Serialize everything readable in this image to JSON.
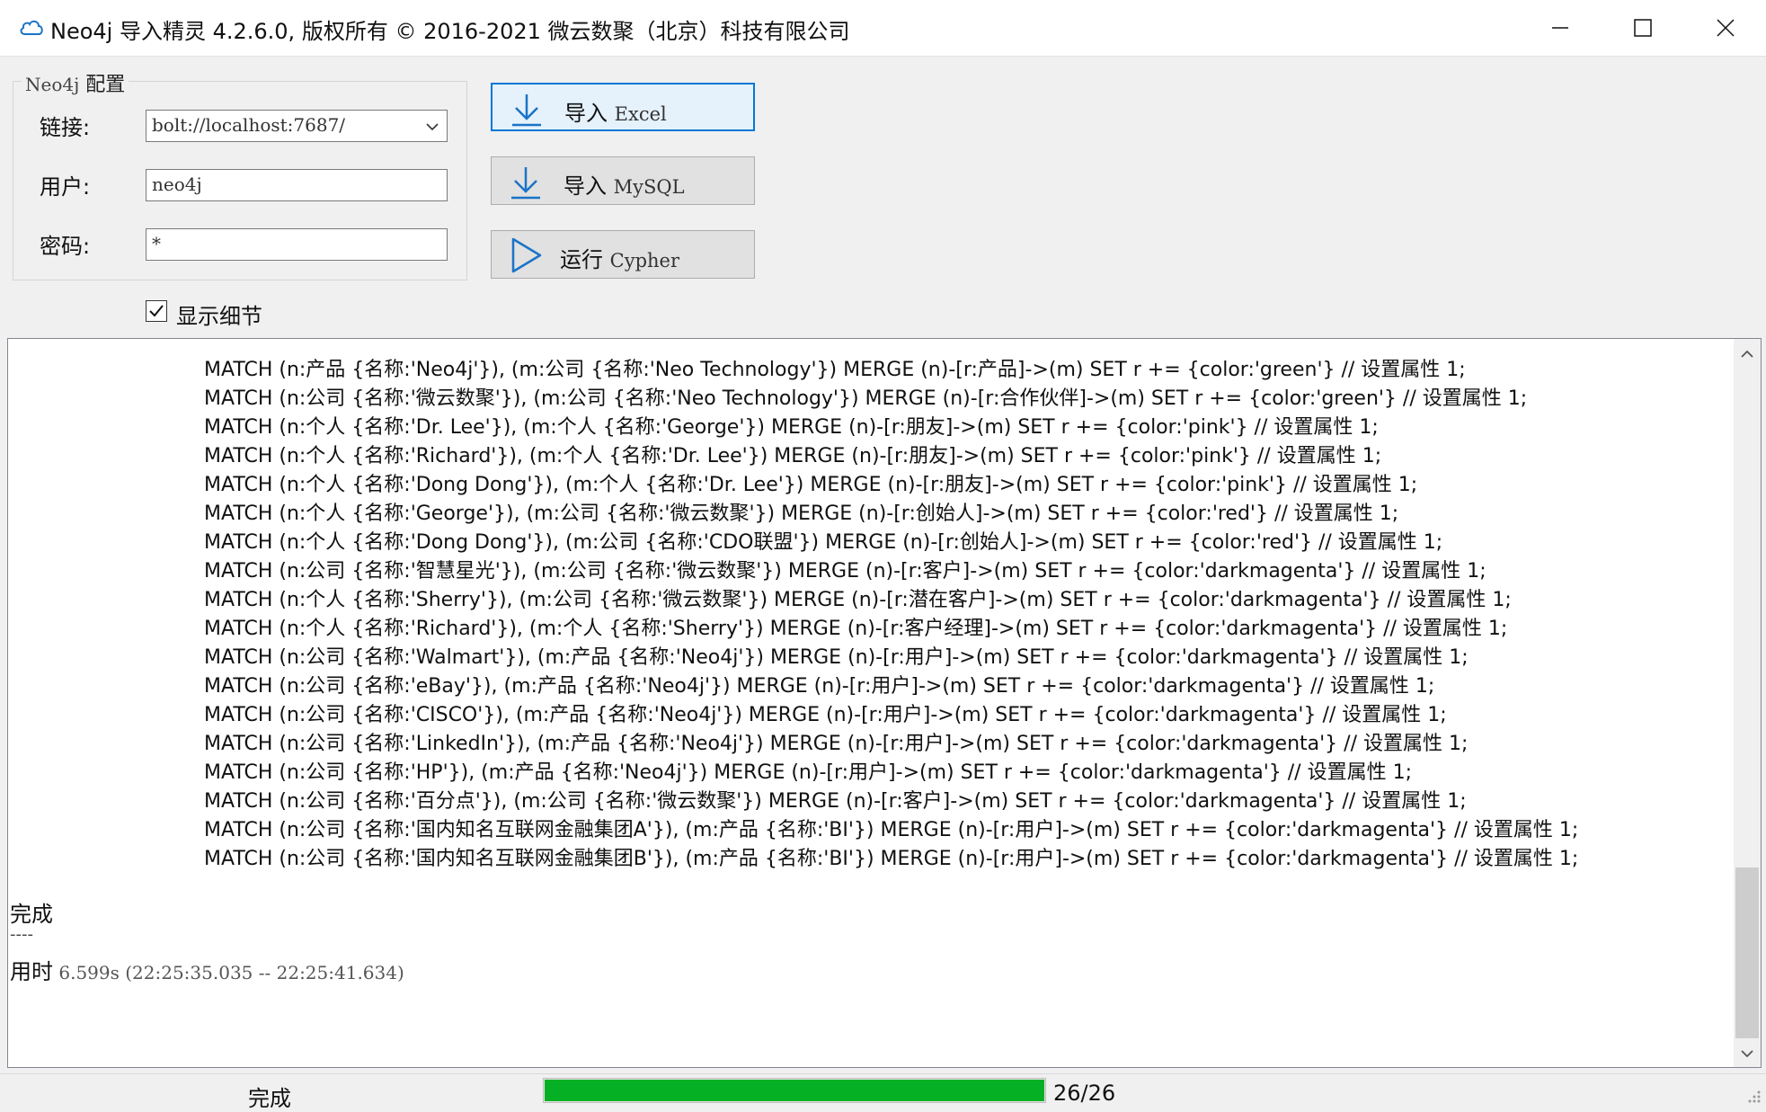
{
  "window": {
    "title": "Neo4j 导入精灵 4.2.6.0, 版权所有 ©  2016-2021 微云数聚（北京）科技有限公司",
    "icon": "cloud-icon"
  },
  "config": {
    "legend_latin": "Neo4j",
    "legend_cn": " 配置",
    "connection_label": "链接:",
    "connection_value": "bolt://localhost:7687/",
    "user_label": "用户:",
    "user_value": "neo4j",
    "password_label": "密码:",
    "password_value": "*",
    "show_detail_label": "显示细节",
    "show_detail_checked": true
  },
  "buttons": {
    "import_excel_cn": "导入 ",
    "import_excel_latin": "Excel",
    "import_mysql_cn": "导入 ",
    "import_mysql_latin": "MySQL",
    "run_cypher_cn": "运行 ",
    "run_cypher_latin": "Cypher"
  },
  "log": {
    "lines": [
      "MATCH (n:产品 {名称:'Neo4j'}), (m:公司 {名称:'Neo Technology'}) MERGE (n)-[r:产品]->(m) SET r += {color:'green'} // 设置属性 1;",
      "MATCH (n:公司 {名称:'微云数聚'}), (m:公司 {名称:'Neo Technology'}) MERGE (n)-[r:合作伙伴]->(m) SET r += {color:'green'} // 设置属性 1;",
      "MATCH (n:个人 {名称:'Dr. Lee'}), (m:个人 {名称:'George'}) MERGE (n)-[r:朋友]->(m) SET r += {color:'pink'} // 设置属性 1;",
      "MATCH (n:个人 {名称:'Richard'}), (m:个人 {名称:'Dr. Lee'}) MERGE (n)-[r:朋友]->(m) SET r += {color:'pink'} // 设置属性 1;",
      "MATCH (n:个人 {名称:'Dong Dong'}), (m:个人 {名称:'Dr. Lee'}) MERGE (n)-[r:朋友]->(m) SET r += {color:'pink'} // 设置属性 1;",
      "MATCH (n:个人 {名称:'George'}), (m:公司 {名称:'微云数聚'}) MERGE (n)-[r:创始人]->(m) SET r += {color:'red'} // 设置属性 1;",
      "MATCH (n:个人 {名称:'Dong Dong'}), (m:公司 {名称:'CDO联盟'}) MERGE (n)-[r:创始人]->(m) SET r += {color:'red'} // 设置属性 1;",
      "MATCH (n:公司 {名称:'智慧星光'}), (m:公司 {名称:'微云数聚'}) MERGE (n)-[r:客户]->(m) SET r += {color:'darkmagenta'} // 设置属性 1;",
      "MATCH (n:个人 {名称:'Sherry'}), (m:公司 {名称:'微云数聚'}) MERGE (n)-[r:潜在客户]->(m) SET r += {color:'darkmagenta'} // 设置属性 1;",
      "MATCH (n:个人 {名称:'Richard'}), (m:个人 {名称:'Sherry'}) MERGE (n)-[r:客户经理]->(m) SET r += {color:'darkmagenta'} // 设置属性 1;",
      "MATCH (n:公司 {名称:'Walmart'}), (m:产品 {名称:'Neo4j'}) MERGE (n)-[r:用户]->(m) SET r += {color:'darkmagenta'} // 设置属性 1;",
      "MATCH (n:公司 {名称:'eBay'}), (m:产品 {名称:'Neo4j'}) MERGE (n)-[r:用户]->(m) SET r += {color:'darkmagenta'} // 设置属性 1;",
      "MATCH (n:公司 {名称:'CISCO'}), (m:产品 {名称:'Neo4j'}) MERGE (n)-[r:用户]->(m) SET r += {color:'darkmagenta'} // 设置属性 1;",
      "MATCH (n:公司 {名称:'LinkedIn'}), (m:产品 {名称:'Neo4j'}) MERGE (n)-[r:用户]->(m) SET r += {color:'darkmagenta'} // 设置属性 1;",
      "MATCH (n:公司 {名称:'HP'}), (m:产品 {名称:'Neo4j'}) MERGE (n)-[r:用户]->(m) SET r += {color:'darkmagenta'} // 设置属性 1;",
      "MATCH (n:公司 {名称:'百分点'}), (m:公司 {名称:'微云数聚'}) MERGE (n)-[r:客户]->(m) SET r += {color:'darkmagenta'} // 设置属性 1;",
      "MATCH (n:公司 {名称:'国内知名互联网金融集团A'}), (m:产品 {名称:'BI'}) MERGE (n)-[r:用户]->(m) SET r += {color:'darkmagenta'} // 设置属性 1;",
      "MATCH (n:公司 {名称:'国内知名互联网金融集团B'}), (m:产品 {名称:'BI'}) MERGE (n)-[r:用户]->(m) SET r += {color:'darkmagenta'} // 设置属性 1;"
    ],
    "done_text": "完成",
    "separator": "----",
    "elapsed_label": "用时",
    "elapsed_value": " 6.599s (22:25:35.035 -- 22:25:41.634)"
  },
  "status": {
    "text": "完成",
    "progress_current": 26,
    "progress_total": 26,
    "progress_text": "26/26",
    "progress_color": "#06b025"
  },
  "colors": {
    "accent": "#0078d7",
    "progress": "#06b025"
  }
}
